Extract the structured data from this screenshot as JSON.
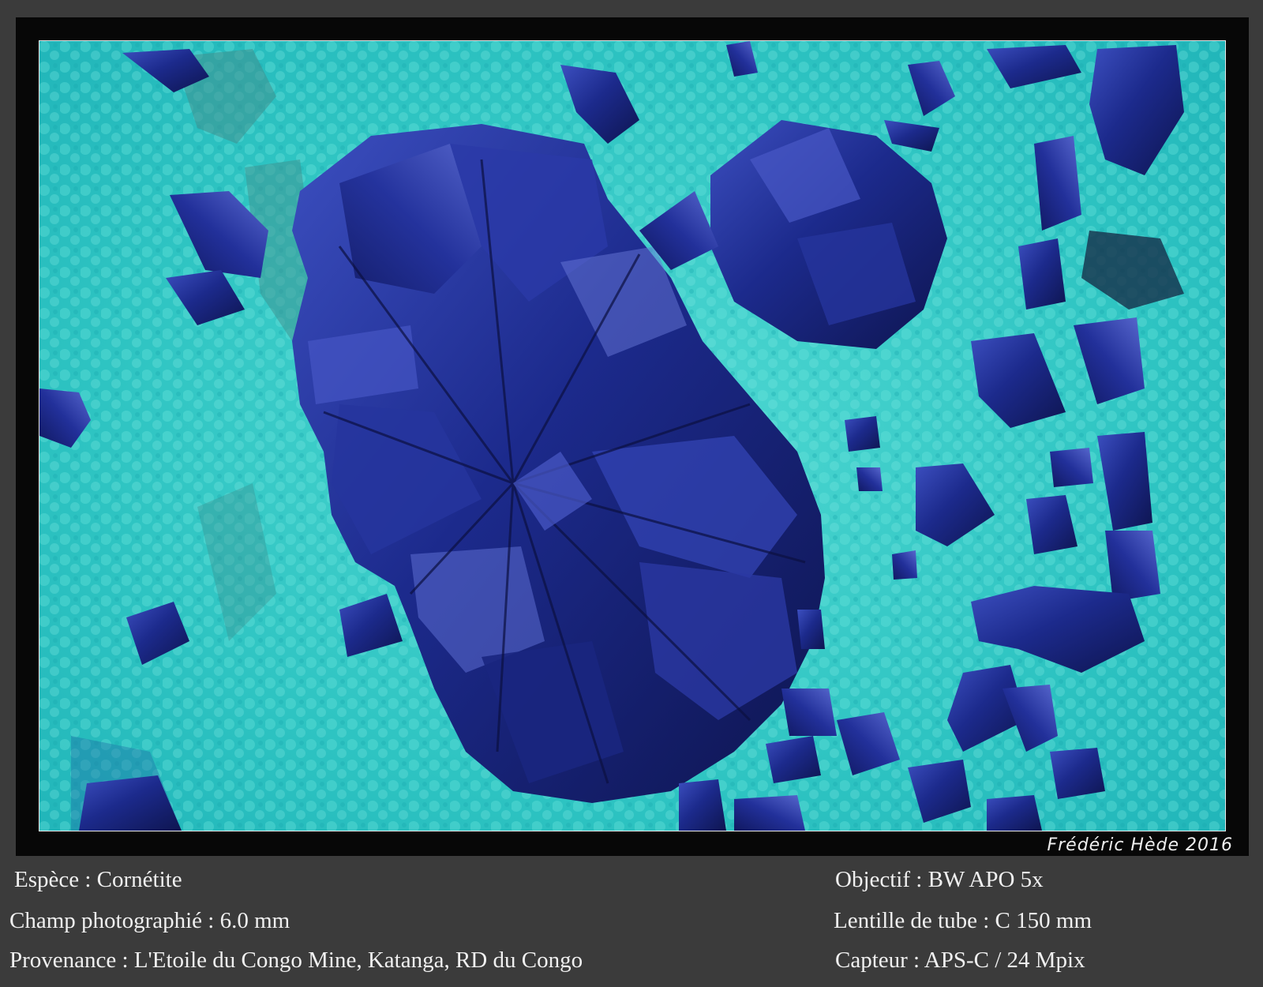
{
  "signature": "Frédéric Hède 2016",
  "captions": {
    "espece": "Espèce : Cornétite",
    "champ": "Champ photographié : 6.0 mm",
    "provenance": "Provenance : L'Etoile du Congo Mine, Katanga, RD du Congo",
    "objectif": "Objectif : BW APO 5x",
    "lentille": "Lentille de tube : C 150 mm",
    "capteur": "Capteur : APS-C / 24 Mpix"
  },
  "colors": {
    "background": "#3b3b3b",
    "frame": "#070707",
    "matrix_turquoise": "#2fc6c3",
    "crystal_blue": "#1c2a8c",
    "text": "#f0f0f0"
  }
}
